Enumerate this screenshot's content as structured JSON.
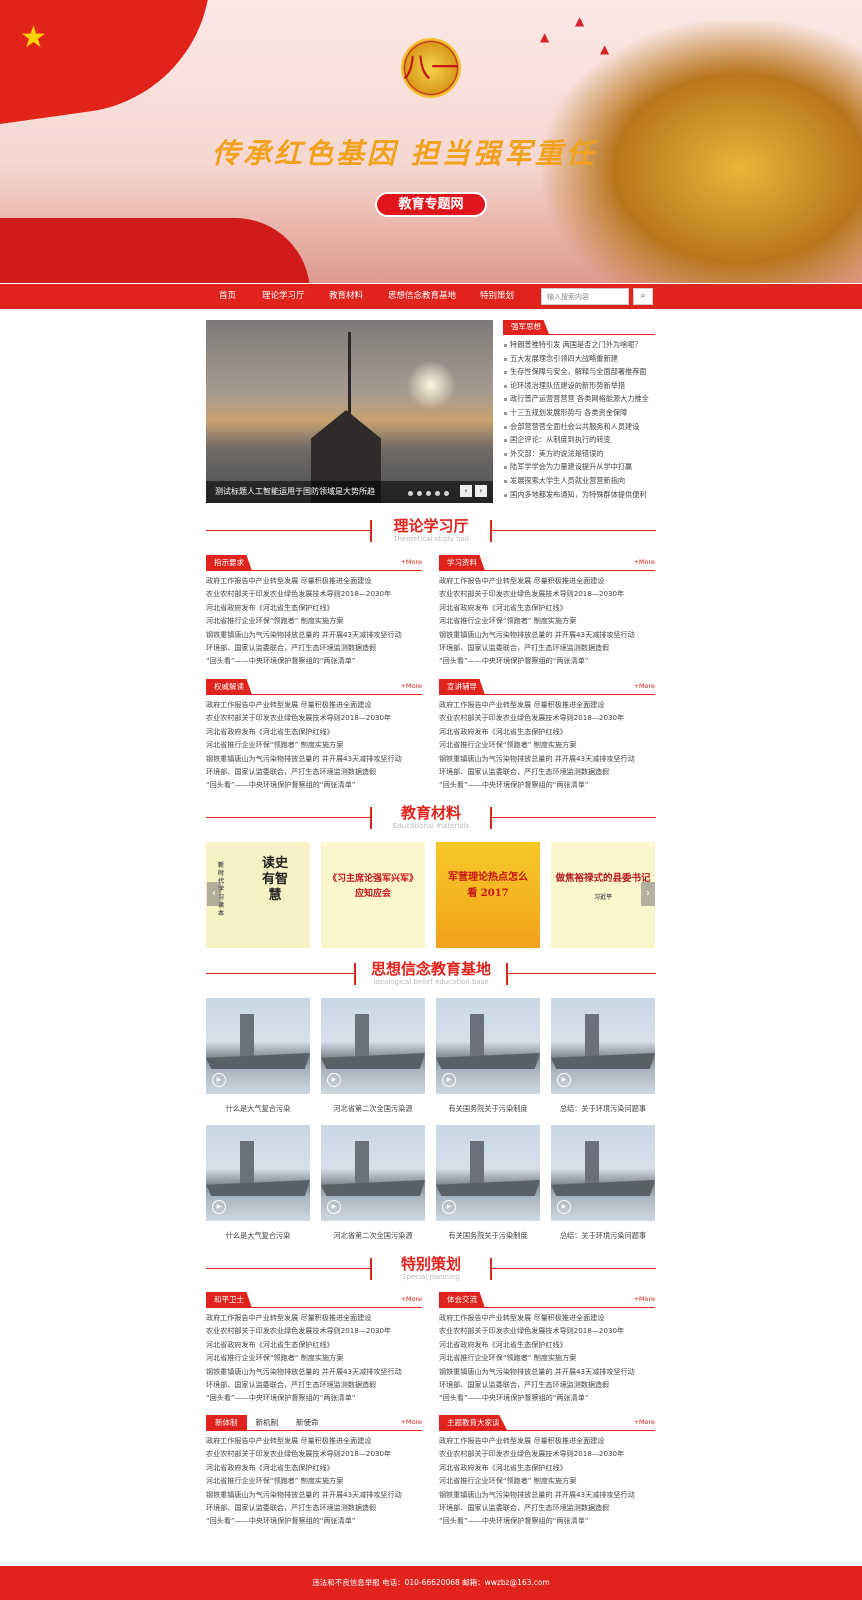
{
  "hero": {
    "slogan": "传承红色基因  担当强军重任",
    "badge": "教育专题网",
    "emblem_text": "八一"
  },
  "nav": {
    "items": [
      "首页",
      "理论学习厅",
      "教育材料",
      "思想信念教育基地",
      "特别策划"
    ],
    "search_placeholder": "输入搜索内容",
    "search_icon": "search-icon"
  },
  "slider": {
    "caption": "测试标题人工智能运用于国防领域是大势所趋"
  },
  "news": {
    "title": "强军思想",
    "items": [
      "特朗普推特引发 两国是否之门外为啥呢？",
      "五大发展理念引领四大战略重新建",
      "生存性保障与安全，解释与全面部署推荐面",
      "论环境治理队伍建设的新形势新举措",
      "政行普产运营营营营 各类网格能源大力推全",
      "十三五规划发展形势与 各类资金保障",
      "会部营营营全面社会公共服务和人员建设",
      "国企评论：从制度到执行的转变",
      "外交部：美方的说法是错误的",
      "陆军学学会为力量建设提升从学中打赢",
      "发展探索大学生人员就业营营新指向",
      "国内多地都发布通知，为特殊群体提供便利"
    ]
  },
  "sections": {
    "theory": {
      "title": "理论学习厅",
      "subtitle": "Theoretical study hall"
    },
    "materials": {
      "title": "教育材料",
      "subtitle": "Educational materials"
    },
    "base": {
      "title": "思想信念教育基地",
      "subtitle": "Ideological belief education base"
    },
    "special": {
      "title": "特别策划",
      "subtitle": "Special planning"
    }
  },
  "more": "+More",
  "article_rows": [
    "政府工作报告中产业转型发展 尽量积极推进全面建设",
    "农业农村部关于印发农业绿色发展技术导则2018—2030年",
    "河北省政府发布《河北省生态保护红线》",
    "河北省推行企业环保“领跑者” 制度实施方案",
    "钢铁重镇唐山为气污染物排放总量的 并开展43天减排攻坚行动",
    "环境部、国家认监委联合，严打生态环境监测数据造假",
    "“回头看”——中央环境保护督察组的“两张清单”"
  ],
  "theory_boxes": [
    {
      "tab": "指示要求"
    },
    {
      "tab": "学习资料"
    },
    {
      "tab": "权威解读"
    },
    {
      "tab": "宣讲辅导"
    }
  ],
  "books": [
    {
      "title": "读史有智慧",
      "sub": "新时代学习读本"
    },
    {
      "title": "《习主席论强军兴军》应知应会",
      "sub": ""
    },
    {
      "title": "军营理论热点怎么看 2017",
      "sub": ""
    },
    {
      "title": "做焦裕禄式的县委书记",
      "sub": "习近平"
    }
  ],
  "videos": [
    "什么是大气复合污染",
    "河北省第二次全国污染源",
    "有关国务院关于污染制度",
    "总结：关于环境污染问题事",
    "什么是大气复合污染",
    "河北省第二次全国污染源",
    "有关国务院关于污染制度",
    "总结：关于环境污染问题事"
  ],
  "special_boxes": [
    {
      "tab": "和平卫士"
    },
    {
      "tab": "体会交流"
    },
    {
      "tabs": [
        "新体制",
        "新机制",
        "新使命"
      ]
    },
    {
      "tab": "主题教育大家谈"
    }
  ],
  "footer": {
    "text": "违法和不良信息举报   电话：010-66620068   邮箱：wwzbz@163.com"
  },
  "colors": {
    "brand": "#e1231d"
  }
}
